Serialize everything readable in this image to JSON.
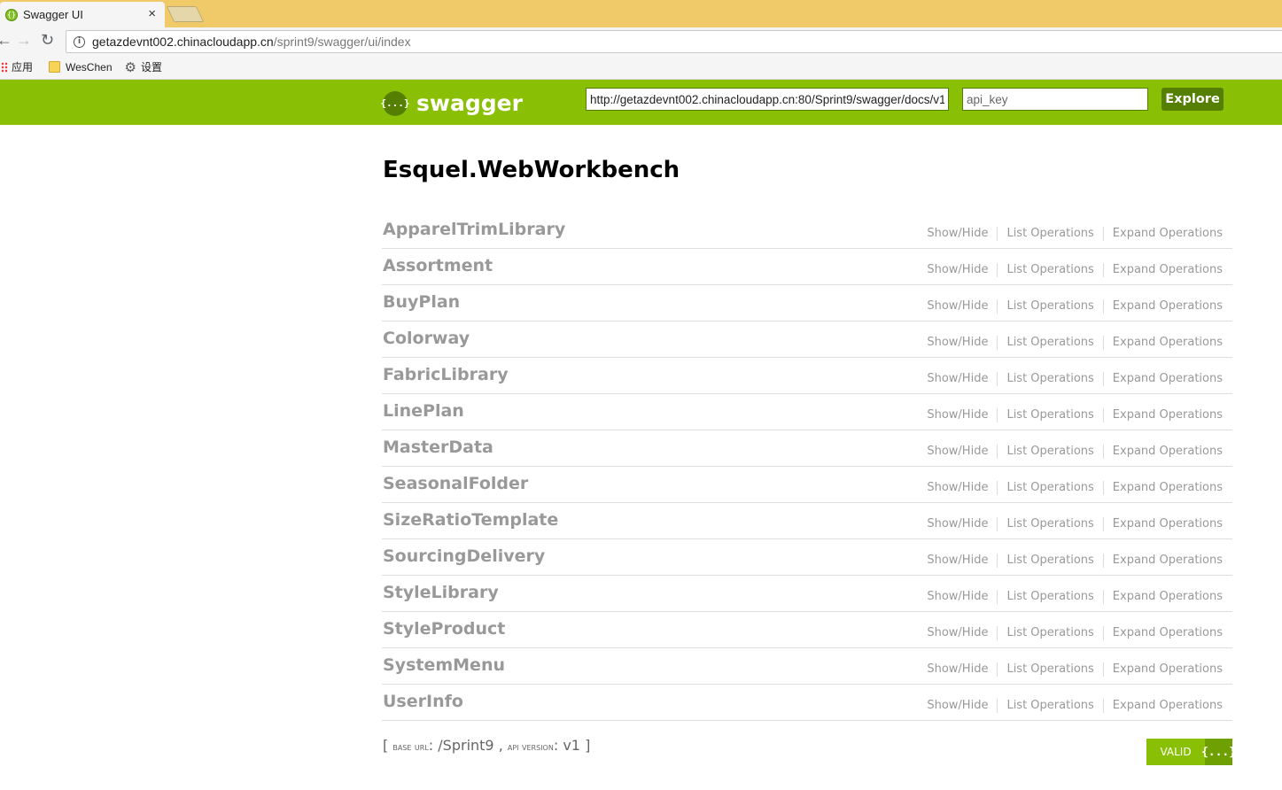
{
  "browser": {
    "tab_title": "Swagger UI",
    "tab_close": "×",
    "url_host": "getazdevnt002.chinacloudapp.cn",
    "url_path": "/sprint9/swagger/ui/index",
    "bookmarks": [
      {
        "label": "应用",
        "icon": "apps-icon"
      },
      {
        "label": "WesChen",
        "icon": "folder-icon"
      },
      {
        "label": "设置",
        "icon": "gear-icon"
      }
    ]
  },
  "swagger_header": {
    "logo_text": "swagger",
    "logo_glyph": "{...}",
    "spec_url": "http://getazdevnt002.chinacloudapp.cn:80/Sprint9/swagger/docs/v1",
    "api_key_placeholder": "api_key",
    "explore_label": "Explore"
  },
  "api_title": "Esquel.WebWorkbench",
  "op_labels": {
    "show_hide": "Show/Hide",
    "list": "List Operations",
    "expand": "Expand Operations"
  },
  "resources": [
    "ApparelTrimLibrary",
    "Assortment",
    "BuyPlan",
    "Colorway",
    "FabricLibrary",
    "LinePlan",
    "MasterData",
    "SeasonalFolder",
    "SizeRatioTemplate",
    "SourcingDelivery",
    "StyleLibrary",
    "StyleProduct",
    "SystemMenu",
    "UserInfo"
  ],
  "footer": {
    "open": "[ ",
    "base_url_label": "base url",
    "base_url": "/Sprint9",
    "separator": " , ",
    "api_version_label": "api version",
    "api_version": "v1",
    "close": " ]"
  },
  "validator": {
    "label": "VALID",
    "glyph": "{...}"
  },
  "colors": {
    "swagger_green": "#89bf04",
    "swagger_dark_green": "#547f00",
    "tabbar": "#f0c968"
  }
}
